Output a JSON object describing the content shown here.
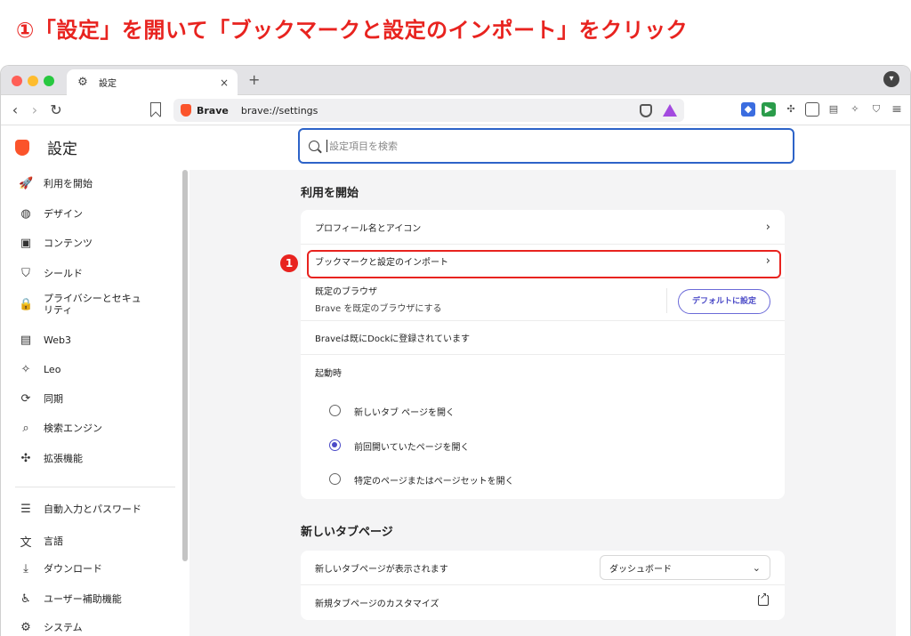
{
  "heading": "①「設定」を開いて「ブックマークと設定のインポート」をクリック",
  "tab": {
    "label": "設定",
    "icon": "gear-icon",
    "close": "×"
  },
  "new_tab": "+",
  "tab_menu": "▾",
  "address": {
    "brand": "Brave",
    "url": "brave://settings"
  },
  "settings": {
    "title": "設定",
    "search_placeholder": "設定項目を検索"
  },
  "sidebar": {
    "items": [
      {
        "label": "利用を開始",
        "icon": "rocket-icon",
        "glyph": "🚀"
      },
      {
        "label": "デザイン",
        "icon": "palette-icon",
        "glyph": "◍"
      },
      {
        "label": "コンテンツ",
        "icon": "content-icon",
        "glyph": "▣"
      },
      {
        "label": "シールド",
        "icon": "shield-icon",
        "glyph": "⛉"
      },
      {
        "label": "プライバシーとセキュリティ",
        "icon": "lock-icon",
        "glyph": "🔒"
      },
      {
        "label": "Web3",
        "icon": "wallet-icon",
        "glyph": "▤"
      },
      {
        "label": "Leo",
        "icon": "leo-icon",
        "glyph": "✧"
      },
      {
        "label": "同期",
        "icon": "sync-icon",
        "glyph": "⟳"
      },
      {
        "label": "検索エンジン",
        "icon": "search-icon",
        "glyph": "⌕"
      },
      {
        "label": "拡張機能",
        "icon": "puzzle-icon",
        "glyph": "✣"
      },
      {
        "label": "自動入力とパスワード",
        "icon": "list-icon",
        "glyph": "☰"
      },
      {
        "label": "言語",
        "icon": "translate-icon",
        "glyph": "文"
      },
      {
        "label": "ダウンロード",
        "icon": "download-icon",
        "glyph": "⤓"
      },
      {
        "label": "ユーザー補助機能",
        "icon": "accessibility-icon",
        "glyph": "♿"
      },
      {
        "label": "システム",
        "icon": "gear-icon",
        "glyph": "⚙"
      }
    ]
  },
  "getting_started": {
    "title": "利用を開始",
    "profile_row": "プロフィール名とアイコン",
    "import_row": "ブックマークと設定のインポート",
    "default_browser_title": "既定のブラウザ",
    "default_browser_sub": "Brave を既定のブラウザにする",
    "default_button": "デフォルトに設定",
    "dock_note": "Braveは既にDockに登録されています",
    "startup_title": "起動時",
    "startup_options": [
      {
        "label": "新しいタブ ページを開く",
        "checked": false
      },
      {
        "label": "前回開いていたページを開く",
        "checked": true
      },
      {
        "label": "特定のページまたはページセットを開く",
        "checked": false
      }
    ],
    "annotation_badge": "1"
  },
  "new_tab_page": {
    "title": "新しいタブページ",
    "shows_label": "新しいタブページが表示されます",
    "shows_value": "ダッシュボード",
    "customize_label": "新規タブページのカスタマイズ"
  },
  "chevron": "›",
  "colors": {
    "annotation_red": "#e8231f",
    "accent": "#4b4ac7",
    "brave_orange": "#fb542b"
  }
}
